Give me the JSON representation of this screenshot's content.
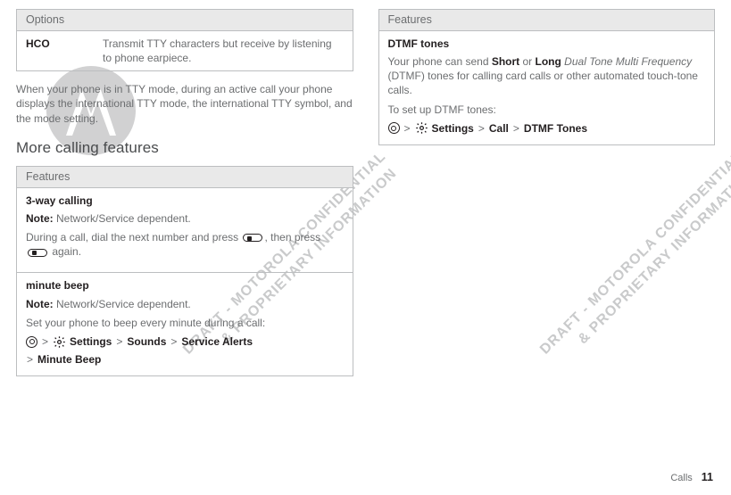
{
  "left": {
    "options_header": "Options",
    "hco": {
      "label": "HCO",
      "desc": "Transmit TTY characters but receive by listening to phone earpiece."
    },
    "tty_para": "When your phone is in TTY mode, during an active call your phone displays the international TTY mode, the international TTY symbol, and the mode setting.",
    "more_heading": "More calling features",
    "features_header": "Features",
    "f1": {
      "title": "3-way calling",
      "note_label": "Note:",
      "note_text": " Network/Service dependent.",
      "line_a": "During a call, dial the next number and press ",
      "line_b": ", then press ",
      "line_c": " again."
    },
    "f2": {
      "title": "minute beep",
      "note_label": "Note:",
      "note_text": " Network/Service dependent.",
      "desc": "Set your phone to beep every minute during a call:",
      "path": {
        "settings": "Settings",
        "sounds": "Sounds",
        "alerts": "Service Alerts",
        "minutebeep": "Minute Beep"
      }
    }
  },
  "right": {
    "features_header": "Features",
    "f3": {
      "title": "DTMF tones",
      "body_a": "Your phone can send ",
      "short": "Short",
      "or": " or ",
      "long": "Long",
      "dtmf_italic": " Dual Tone Multi Frequency",
      "body_b": " (DTMF) tones for calling card calls or other automated touch-tone calls.",
      "setup": "To set up DTMF tones:",
      "path": {
        "settings": "Settings",
        "call": "Call",
        "dtmf": "DTMF Tones"
      }
    }
  },
  "watermark_line1": "DRAFT - MOTOROLA CONFIDENTIAL",
  "watermark_line2": "& PROPRIETARY INFORMATION",
  "footer_section": "Calls",
  "footer_page": "11"
}
